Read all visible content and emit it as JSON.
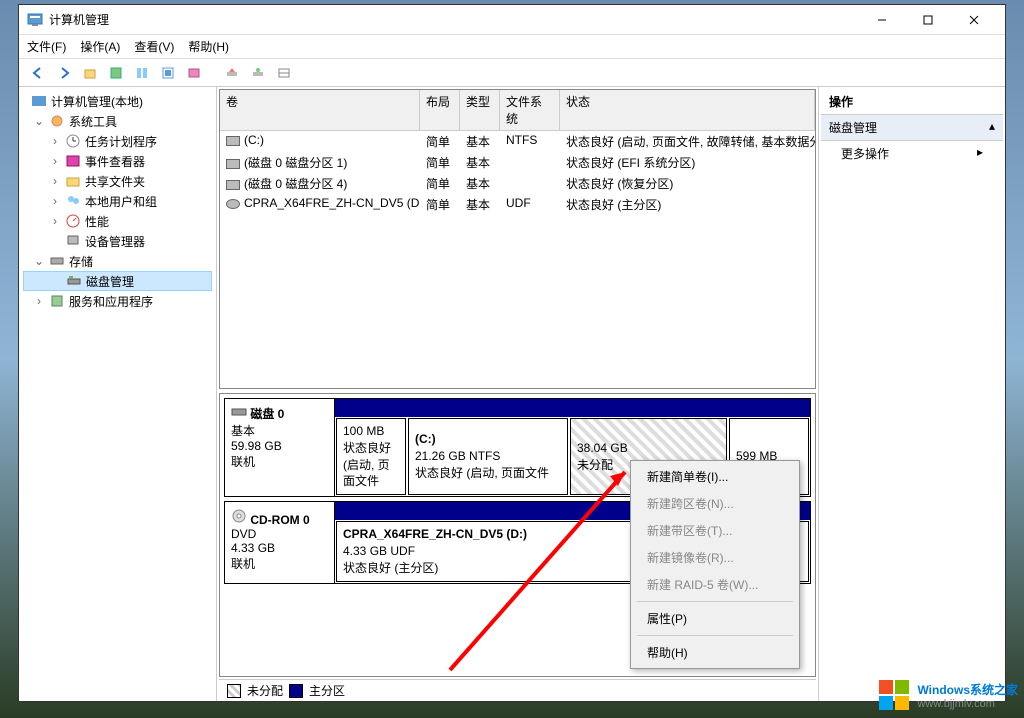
{
  "window": {
    "title": "计算机管理"
  },
  "menu": {
    "file": "文件(F)",
    "action": "操作(A)",
    "view": "查看(V)",
    "help": "帮助(H)"
  },
  "tree": {
    "root": "计算机管理(本地)",
    "tools": "系统工具",
    "task": "任务计划程序",
    "event": "事件查看器",
    "shared": "共享文件夹",
    "users": "本地用户和组",
    "perf": "性能",
    "devmgr": "设备管理器",
    "storage": "存储",
    "diskmgmt": "磁盘管理",
    "services": "服务和应用程序"
  },
  "volcols": {
    "vol": "卷",
    "layout": "布局",
    "type": "类型",
    "fs": "文件系统",
    "status": "状态"
  },
  "vols": [
    {
      "name": "(C:)",
      "layout": "简单",
      "type": "基本",
      "fs": "NTFS",
      "status": "状态良好 (启动, 页面文件, 故障转储, 基本数据分"
    },
    {
      "name": "(磁盘 0 磁盘分区 1)",
      "layout": "简单",
      "type": "基本",
      "fs": "",
      "status": "状态良好 (EFI 系统分区)"
    },
    {
      "name": "(磁盘 0 磁盘分区 4)",
      "layout": "简单",
      "type": "基本",
      "fs": "",
      "status": "状态良好 (恢复分区)"
    },
    {
      "name": "CPRA_X64FRE_ZH-CN_DV5 (D:)",
      "layout": "简单",
      "type": "基本",
      "fs": "UDF",
      "status": "状态良好 (主分区)"
    }
  ],
  "disk0": {
    "title": "磁盘 0",
    "type": "基本",
    "size": "59.98 GB",
    "online": "联机",
    "p1": {
      "size": "100 MB",
      "st": "状态良好 (启动, 页面文件"
    },
    "p2": {
      "name": "(C:)",
      "size": "21.26 GB NTFS",
      "st": "状态良好 (启动, 页面文件"
    },
    "p3": {
      "size": "38.04 GB",
      "st": "未分配"
    },
    "p4": {
      "size": "599 MB"
    }
  },
  "cdrom": {
    "title": "CD-ROM 0",
    "type": "DVD",
    "size": "4.33 GB",
    "online": "联机",
    "p": {
      "name": "CPRA_X64FRE_ZH-CN_DV5  (D:)",
      "size": "4.33 GB UDF",
      "st": "状态良好 (主分区)"
    }
  },
  "legend": {
    "unalloc": "未分配",
    "primary": "主分区"
  },
  "actions": {
    "title": "操作",
    "group": "磁盘管理",
    "more": "更多操作"
  },
  "ctx": {
    "simple": "新建简单卷(I)...",
    "span": "新建跨区卷(N)...",
    "stripe": "新建带区卷(T)...",
    "mirror": "新建镜像卷(R)...",
    "raid5": "新建 RAID-5 卷(W)...",
    "prop": "属性(P)",
    "help": "帮助(H)"
  },
  "watermark": {
    "main": "Windows系统之家",
    "sub": "www.bjjmlv.com"
  }
}
